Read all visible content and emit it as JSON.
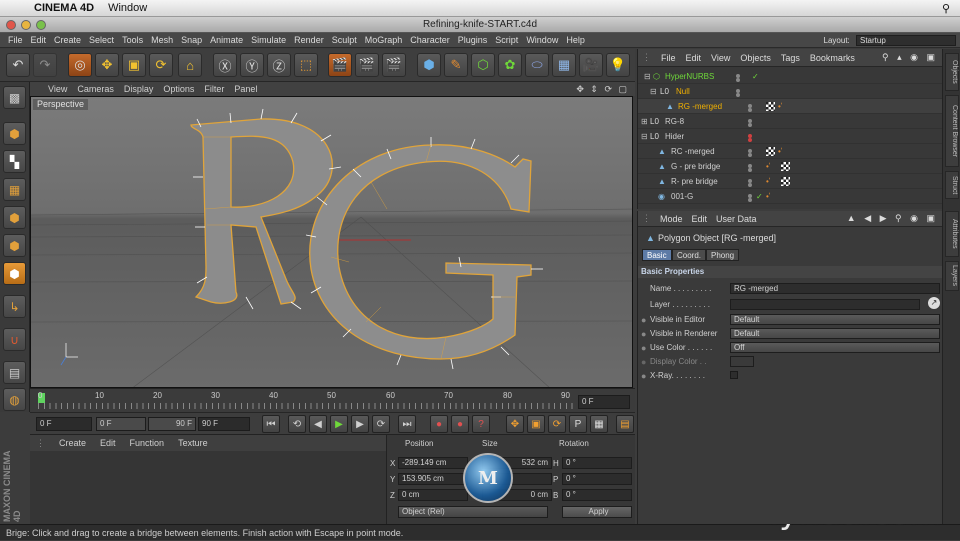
{
  "mac_menubar": {
    "app_name": "CINEMA 4D",
    "items": [
      "Window"
    ]
  },
  "window": {
    "title": "Refining-knife-START.c4d"
  },
  "main_menu": [
    "File",
    "Edit",
    "Create",
    "Select",
    "Tools",
    "Mesh",
    "Snap",
    "Animate",
    "Simulate",
    "Render",
    "Sculpt",
    "MoGraph",
    "Character",
    "Plugins",
    "Script",
    "Window",
    "Help"
  ],
  "layout": {
    "label": "Layout:",
    "value": "Startup"
  },
  "viewport": {
    "menu": [
      "View",
      "Cameras",
      "Display",
      "Options",
      "Filter",
      "Panel"
    ],
    "label": "Perspective"
  },
  "timeline": {
    "ticks": [
      "0",
      "10",
      "20",
      "30",
      "40",
      "50",
      "60",
      "70",
      "80",
      "90"
    ],
    "current_frame": "0 F"
  },
  "transport": {
    "start": "0 F",
    "range_start": "0 F",
    "range_end": "90 F",
    "end": "90 F"
  },
  "material_manager": {
    "menu": [
      "Create",
      "Edit",
      "Function",
      "Texture"
    ]
  },
  "coordinates": {
    "headers": {
      "position": "Position",
      "size": "Size",
      "rotation": "Rotation"
    },
    "axes": [
      "X",
      "Y",
      "Z"
    ],
    "rot_axes": [
      "H",
      "P",
      "B"
    ],
    "position": [
      "-289.149 cm",
      "153.905 cm",
      "0 cm"
    ],
    "size": [
      "532 cm",
      "",
      "0 cm"
    ],
    "rotation": [
      "0 °",
      "0 °",
      "0 °"
    ],
    "mode": "Object (Rel)",
    "apply": "Apply"
  },
  "object_manager": {
    "menu": [
      "File",
      "Edit",
      "View",
      "Objects",
      "Tags",
      "Bookmarks"
    ],
    "rows": [
      {
        "name": "HyperNURBS",
        "color": "#6fd83a"
      },
      {
        "name": "Null",
        "color": "#f0b000"
      },
      {
        "name": "RG -merged",
        "color": "#f0b000"
      },
      {
        "name": "RG-8",
        "color": "#d0d0d0"
      },
      {
        "name": "Hider",
        "color": "#d0d0d0"
      },
      {
        "name": "RC -merged",
        "color": "#d0d0d0"
      },
      {
        "name": "G - pre bridge",
        "color": "#d0d0d0"
      },
      {
        "name": "R- pre bridge",
        "color": "#d0d0d0"
      },
      {
        "name": "001-G",
        "color": "#d0d0d0"
      }
    ]
  },
  "attribute_manager": {
    "menu": [
      "Mode",
      "Edit",
      "User Data"
    ],
    "object_title": "Polygon Object [RG -merged]",
    "tabs": [
      "Basic",
      "Coord.",
      "Phong"
    ],
    "section": "Basic Properties",
    "fields": [
      {
        "label": "Name . . . . . . . . .",
        "value": "RG -merged"
      },
      {
        "label": "Layer . . . . . . . . .",
        "value": ""
      },
      {
        "label": "Visible in Editor",
        "value": "Default"
      },
      {
        "label": "Visible in Renderer",
        "value": "Default"
      },
      {
        "label": "Use Color . . . . . .",
        "value": "Off"
      },
      {
        "label": "Display Color . .",
        "value": ""
      },
      {
        "label": "X-Ray. . . . . . . .",
        "value": ""
      }
    ]
  },
  "right_tabs": [
    "Objects",
    "Content Browser",
    "Struct",
    "Attributes",
    "Layers"
  ],
  "status": "Brige: Click and drag to create a bridge between elements. Finish action with Escape in point mode.",
  "branding": {
    "left": "MAXON CINEMA 4D",
    "watermark": "lynda.com"
  }
}
